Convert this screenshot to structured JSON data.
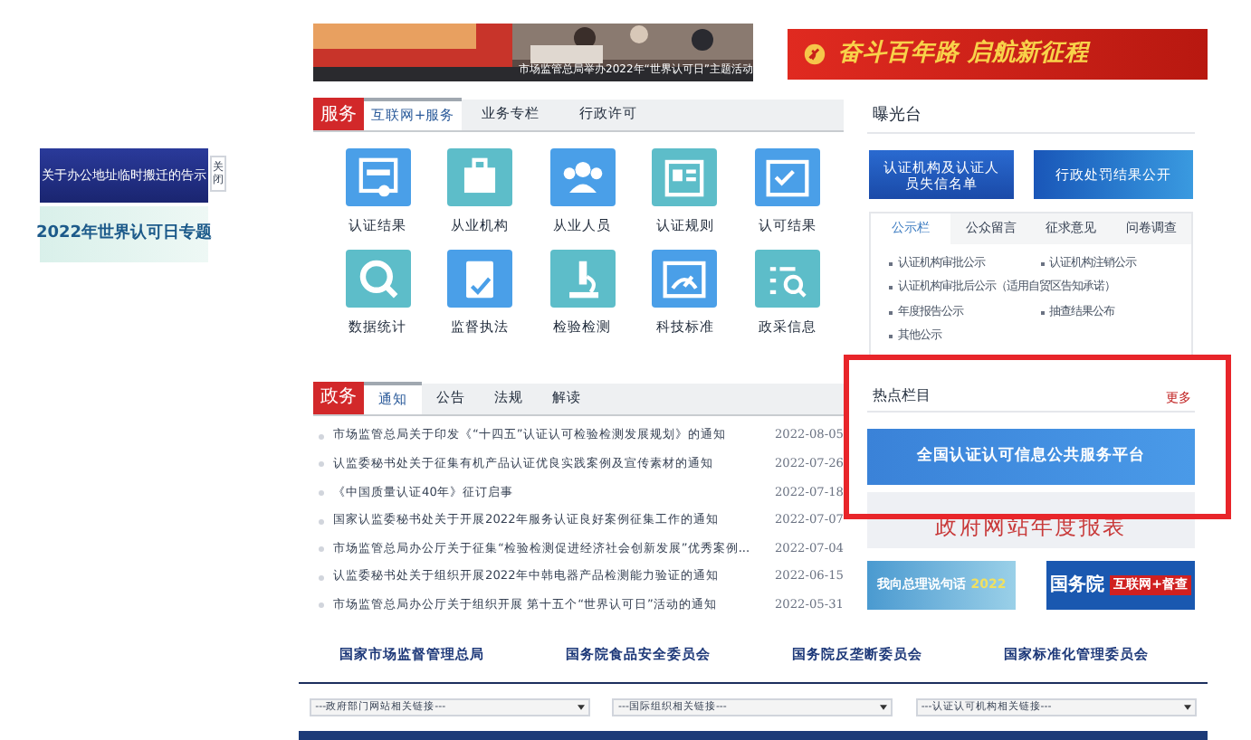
{
  "floating_notice": {
    "items": [
      "关于办公地址临时搬迁的告示",
      "2022年世界认可日专题"
    ],
    "close": "关闭"
  },
  "top_banner": {
    "caption": "市场监管总局举办2022年“世界认可日”主题活动"
  },
  "party_banner": {
    "text": "奋斗百年路 启航新征程"
  },
  "service": {
    "badge": "服务",
    "tabs": [
      {
        "label": "互联网+服务",
        "selected": true
      },
      {
        "label": "业务专栏",
        "selected": false
      },
      {
        "label": "行政许可",
        "selected": false
      }
    ],
    "tiles": [
      {
        "label": "认证结果",
        "color": "#4a9fe8"
      },
      {
        "label": "从业机构",
        "color": "#5dbdc9"
      },
      {
        "label": "从业人员",
        "color": "#4a9fe8"
      },
      {
        "label": "认证规则",
        "color": "#5dbdc9"
      },
      {
        "label": "认可结果",
        "color": "#4a9fe8"
      },
      {
        "label": "数据统计",
        "color": "#5dbdc9"
      },
      {
        "label": "监督执法",
        "color": "#4a9fe8"
      },
      {
        "label": "检验检测",
        "color": "#5dbdc9"
      },
      {
        "label": "科技标准",
        "color": "#4a9fe8"
      },
      {
        "label": "政采信息",
        "color": "#5dbdc9"
      }
    ]
  },
  "affairs": {
    "badge": "政务",
    "tabs": [
      {
        "label": "通知",
        "selected": true
      },
      {
        "label": "公告",
        "selected": false
      },
      {
        "label": "法规",
        "selected": false
      },
      {
        "label": "解读",
        "selected": false
      }
    ],
    "news": [
      {
        "title": "市场监管总局关于印发《“十四五”认证认可检验检测发展规划》的通知",
        "date": "2022-08-05"
      },
      {
        "title": "认监委秘书处关于征集有机产品认证优良实践案例及宣传素材的通知",
        "date": "2022-07-26"
      },
      {
        "title": "《中国质量认证40年》征订启事",
        "date": "2022-07-18"
      },
      {
        "title": "国家认监委秘书处关于开展2022年服务认证良好案例征集工作的通知",
        "date": "2022-07-07"
      },
      {
        "title": "市场监管总局办公厅关于征集“检验检测促进经济社会创新发展”优秀案例...",
        "date": "2022-07-04"
      },
      {
        "title": "认监委秘书处关于组织开展2022年中韩电器产品检测能力验证的通知",
        "date": "2022-06-15"
      },
      {
        "title": "市场监管总局办公厅关于组织开展 第十五个“世界认可日”活动的通知",
        "date": "2022-05-31"
      }
    ]
  },
  "exposure": {
    "title": "曝光台",
    "buttons": [
      "认证机构及认证人员失信名单",
      "行政处罚结果公开"
    ],
    "tabs": [
      {
        "label": "公示栏",
        "selected": true
      },
      {
        "label": "公众留言",
        "selected": false
      },
      {
        "label": "征求意见",
        "selected": false
      },
      {
        "label": "问卷调查",
        "selected": false
      }
    ],
    "items": [
      "认证机构审批公示",
      "认证机构注销公示",
      "认证机构审批后公示（适用自贸区告知承诺）",
      "年度报告公示",
      "抽查结果公布",
      "其他公示"
    ]
  },
  "hot": {
    "title": "热点栏目",
    "more": "更多",
    "banners": [
      "全国认证认可信息公共服务平台",
      "政府网站年度报表"
    ],
    "small_banners": [
      {
        "main": "我向总理说句话",
        "extra": "2022"
      },
      {
        "main": "国务院",
        "extra": "互联网+督查"
      }
    ]
  },
  "links": [
    "国家市场监督管理总局",
    "国务院食品安全委员会",
    "国务院反垄断委员会",
    "国家标准化管理委员会"
  ],
  "selects": [
    "---政府部门网站相关链接---",
    "---国际组织相关链接---",
    "---认证认可机构相关链接---"
  ]
}
